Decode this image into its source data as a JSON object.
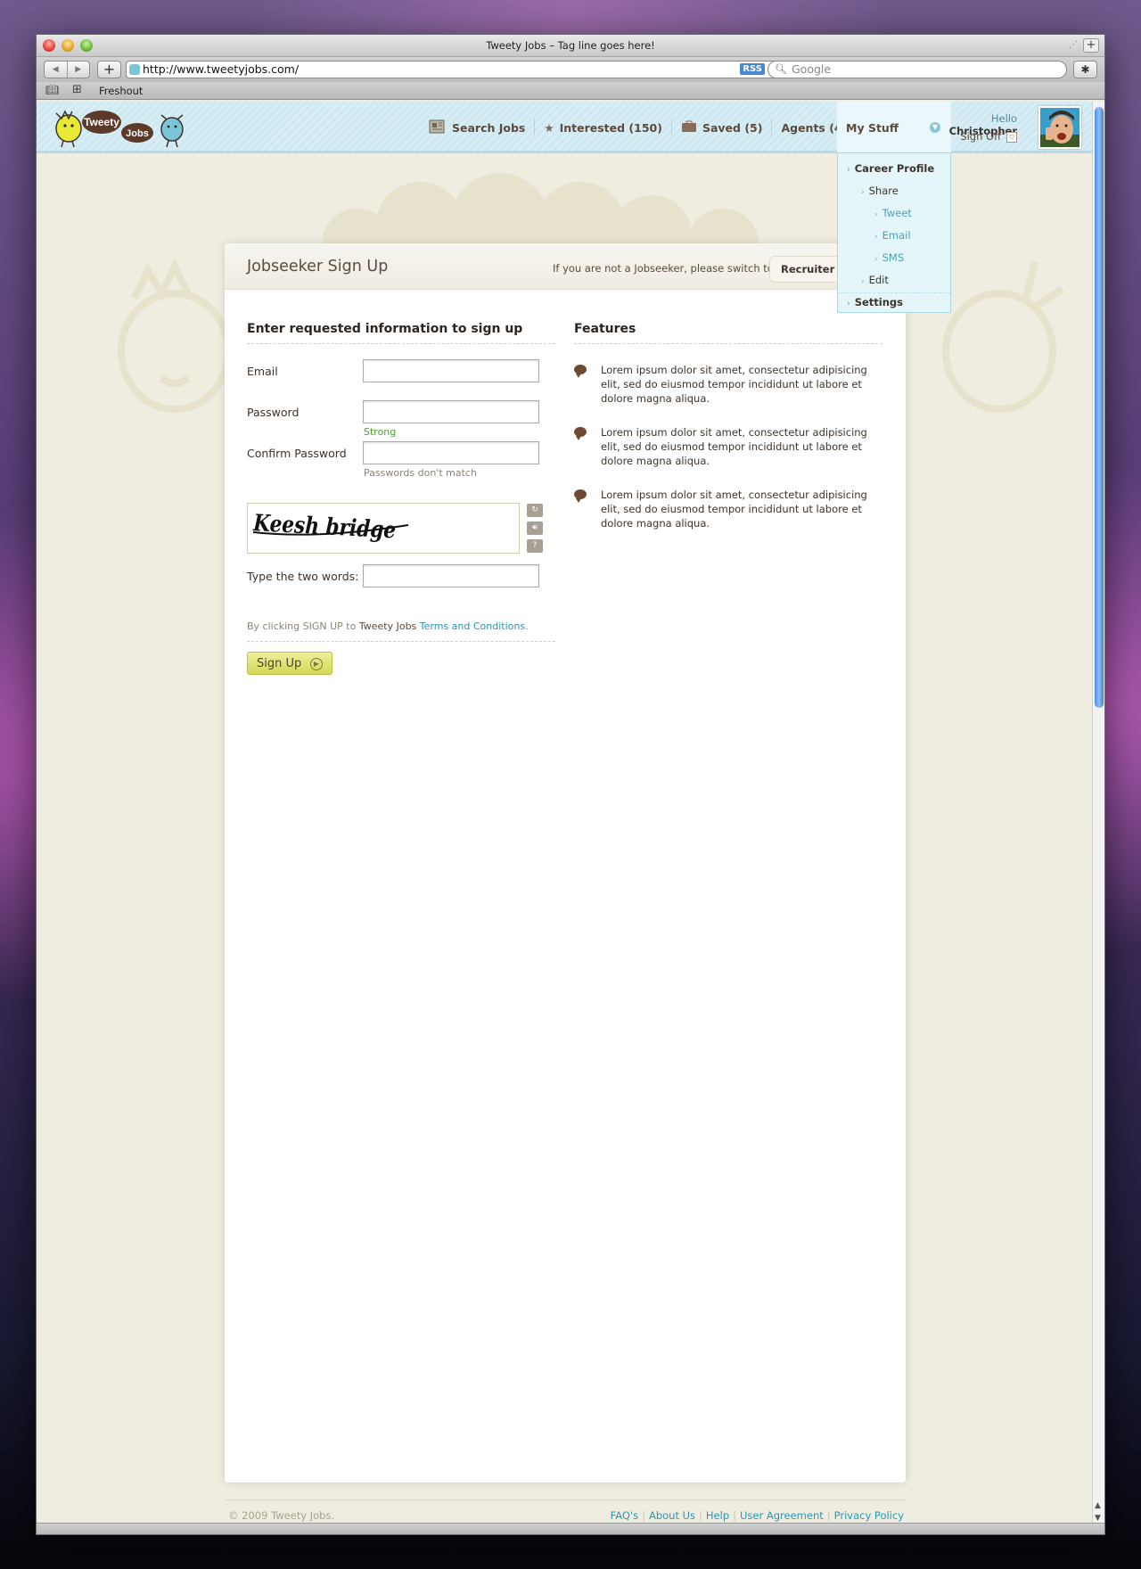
{
  "browser": {
    "window_title": "Tweety Jobs – Tag line goes here!",
    "url": "http://www.tweetyjobs.com/",
    "rss_label": "RSS",
    "search_placeholder": "Google",
    "bookmark": "Freshout"
  },
  "header": {
    "logo_text_1": "Tweety",
    "logo_text_2": "Jobs",
    "nav": [
      {
        "label": "Search Jobs",
        "icon": "newspaper-icon"
      },
      {
        "label": "Interested (150)",
        "icon": "star-icon"
      },
      {
        "label": "Saved (5)",
        "icon": "briefcase-icon"
      },
      {
        "label": "Agents (4)",
        "icon": "chevron-down-icon"
      }
    ],
    "mystuff_label": "My Stuff",
    "hello_prefix": "Hello",
    "user_name": "Christopher",
    "signoff_label": "Sign Off"
  },
  "dropdown": {
    "career_profile": "Career Profile",
    "share": "Share",
    "tweet": "Tweet",
    "email": "Email",
    "sms": "SMS",
    "edit": "Edit",
    "settings": "Settings"
  },
  "card": {
    "title": "Jobseeker Sign Up",
    "switch_text": "If you are not a Jobseeker, please switch to",
    "recruiter_tab": "Recruiter Sign Up"
  },
  "form": {
    "section_title": "Enter requested information to sign up",
    "email_label": "Email",
    "password_label": "Password",
    "password_strength": "Strong",
    "confirm_label": "Confirm Password",
    "confirm_error": "Passwords don't match",
    "captcha_words": "Keesh bridge",
    "captcha_label": "Type the two words:",
    "terms_prefix": "By clicking SIGN UP to",
    "terms_brand": "Tweety Jobs",
    "terms_link": "Terms and Conditions",
    "terms_suffix": ".",
    "signup_label": "Sign Up"
  },
  "features": {
    "title": "Features",
    "items": [
      "Lorem ipsum dolor sit amet, consectetur adipisicing elit, sed do eiusmod tempor incididunt ut labore et dolore magna aliqua.",
      "Lorem ipsum dolor sit amet, consectetur adipisicing elit, sed do eiusmod tempor incididunt ut labore et dolore magna aliqua.",
      "Lorem ipsum dolor sit amet, consectetur adipisicing elit, sed do eiusmod tempor incididunt ut labore et dolore magna aliqua."
    ]
  },
  "footer": {
    "copyright": "© 2009 Tweety Jobs.",
    "links": [
      "FAQ's",
      "About Us",
      "Help",
      "User Agreement",
      "Privacy Policy"
    ],
    "separator": "|"
  },
  "colors": {
    "header_bg": "#d8eef5",
    "accent_link": "#2a96b4",
    "brown_text": "#5c4a3c",
    "strong_green": "#4aa02c",
    "signup_button": "#e4e678"
  }
}
